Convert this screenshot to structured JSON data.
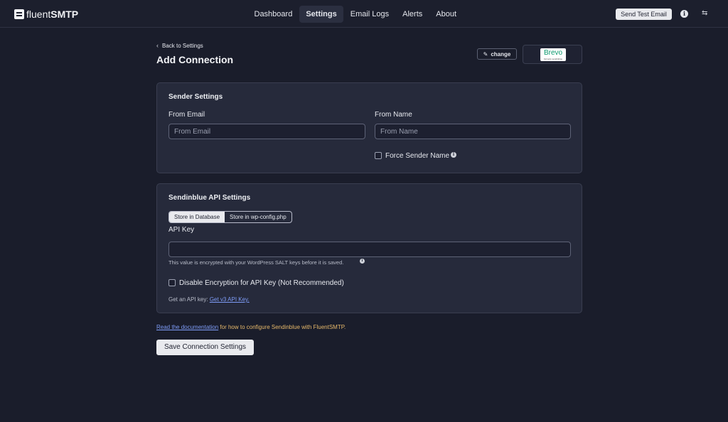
{
  "app": {
    "logo_text_light": "fluent",
    "logo_text_bold": "SMTP"
  },
  "nav": {
    "items": [
      {
        "label": "Dashboard"
      },
      {
        "label": "Settings"
      },
      {
        "label": "Email Logs"
      },
      {
        "label": "Alerts"
      },
      {
        "label": "About"
      }
    ],
    "active": "Settings"
  },
  "topbar": {
    "send_test_label": "Send Test Email",
    "info_icon": "i",
    "swap_icon": "⇆"
  },
  "header": {
    "back_label": "Back to Settings",
    "title": "Add Connection",
    "change_label": "change",
    "provider_logo_text": "Brevo",
    "provider_logo_sub": "formerly sendinblue"
  },
  "sender": {
    "title": "Sender Settings",
    "from_email_label": "From Email",
    "from_email_placeholder": "From Email",
    "from_email_value": "",
    "from_name_label": "From Name",
    "from_name_placeholder": "From Name",
    "from_name_value": "",
    "force_sender_label": "Force Sender Name"
  },
  "api": {
    "title": "Sendinblue API Settings",
    "store_options": [
      "Store in Database",
      "Store in wp-config.php"
    ],
    "store_selected": "Store in Database",
    "api_key_label": "API Key",
    "api_key_value": "",
    "api_key_help": "This value is encrypted with your WordPress SALT keys before it is saved.",
    "disable_encryption_label": "Disable Encryption for API Key (Not Recommended)",
    "get_key_prefix": "Get an API key: ",
    "get_key_link": "Get v3 API Key."
  },
  "footer": {
    "doc_link": "Read the documentation",
    "doc_suffix": " for how to configure Sendinblue with FluentSMTP.",
    "save_label": "Save Connection Settings"
  },
  "colors": {
    "background": "#1a1d2b",
    "panel": "#262a3b",
    "link": "#7e9cf7",
    "brevo_green": "#0b996e"
  }
}
